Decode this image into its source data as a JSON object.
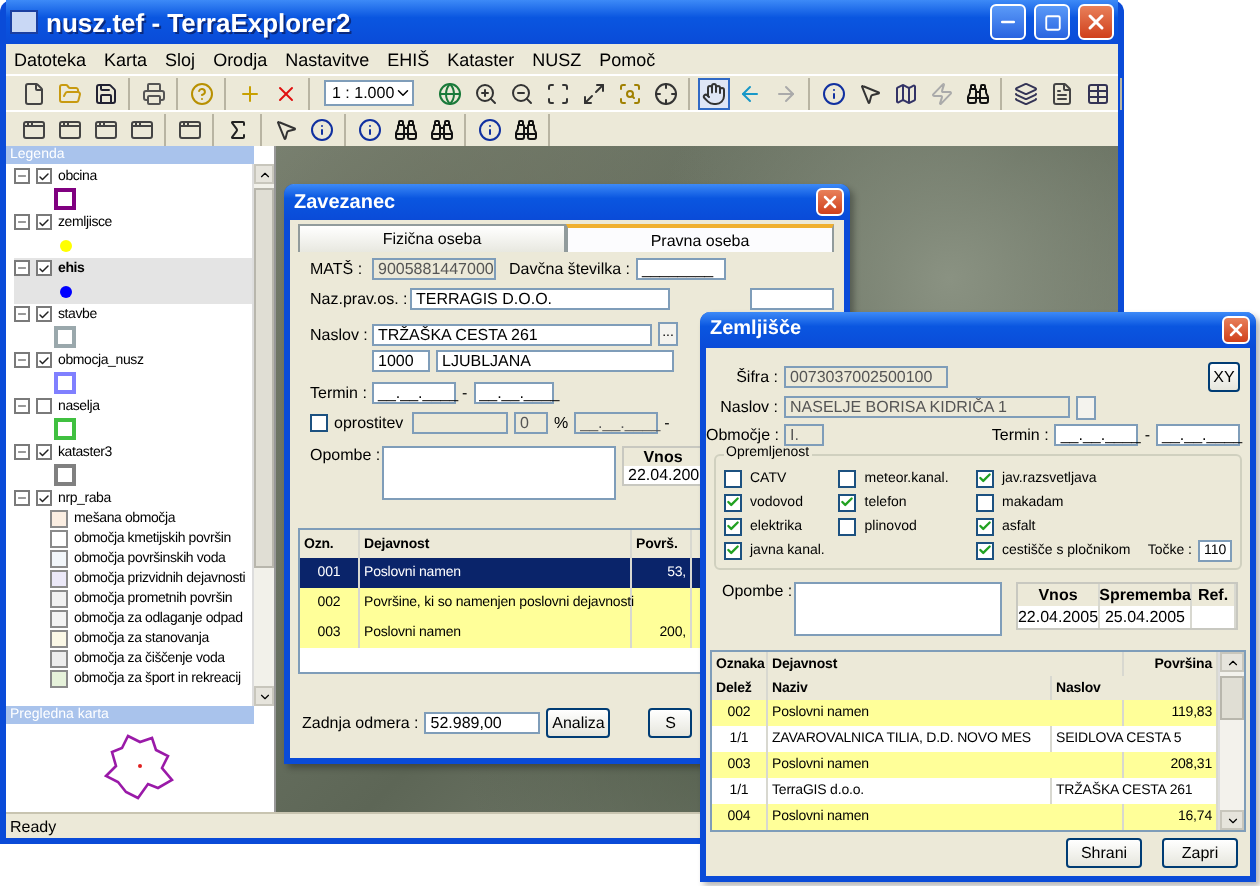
{
  "window": {
    "title": "nusz.tef - TerraExplorer2"
  },
  "menu": [
    "Datoteka",
    "Karta",
    "Sloj",
    "Orodja",
    "Nastavitve",
    "EHIŠ",
    "Kataster",
    "NUSZ",
    "Pomoč"
  ],
  "toolbar": {
    "left_groups": [
      [
        {
          "kind": "new",
          "pressed": false,
          "disabled": false
        },
        {
          "kind": "open",
          "pressed": false,
          "disabled": false
        },
        {
          "kind": "save",
          "pressed": false,
          "disabled": false
        }
      ],
      [
        {
          "kind": "print",
          "pressed": false,
          "disabled": false
        }
      ],
      [
        {
          "kind": "help",
          "pressed": false,
          "disabled": false
        }
      ],
      [
        {
          "kind": "add",
          "pressed": false,
          "disabled": false
        },
        {
          "kind": "delete",
          "pressed": false,
          "disabled": false
        }
      ]
    ],
    "scale": "1 : 1.000",
    "right_groups": [
      [
        {
          "kind": "globe",
          "pressed": false,
          "disabled": false
        },
        {
          "kind": "zoom-in",
          "pressed": false,
          "disabled": false
        },
        {
          "kind": "zoom-out",
          "pressed": false,
          "disabled": false
        },
        {
          "kind": "zoom-extent",
          "pressed": false,
          "disabled": false
        },
        {
          "kind": "zoom-window",
          "pressed": false,
          "disabled": false
        },
        {
          "kind": "zoom-select",
          "pressed": false,
          "disabled": false
        },
        {
          "kind": "zoom-layer",
          "pressed": false,
          "disabled": false
        }
      ],
      [
        {
          "kind": "hand",
          "pressed": true,
          "disabled": false
        },
        {
          "kind": "back",
          "pressed": false,
          "disabled": false
        },
        {
          "kind": "forward",
          "pressed": false,
          "disabled": true
        }
      ],
      [
        {
          "kind": "info",
          "pressed": false,
          "disabled": false
        },
        {
          "kind": "pointer",
          "pressed": false,
          "disabled": false
        },
        {
          "kind": "map",
          "pressed": false,
          "disabled": false
        },
        {
          "kind": "lightning",
          "pressed": false,
          "disabled": true
        },
        {
          "kind": "binoculars",
          "pressed": false,
          "disabled": false
        }
      ],
      [
        {
          "kind": "layers",
          "pressed": false,
          "disabled": false
        },
        {
          "kind": "document",
          "pressed": false,
          "disabled": false
        },
        {
          "kind": "table",
          "pressed": false,
          "disabled": false
        }
      ]
    ]
  },
  "toolbar2": [
    [
      {
        "kind": "frame"
      },
      {
        "kind": "frame"
      },
      {
        "kind": "frame"
      },
      {
        "kind": "frame"
      }
    ],
    [
      {
        "kind": "frame"
      }
    ],
    [
      {
        "kind": "sigma"
      }
    ],
    [
      {
        "kind": "pointer"
      },
      {
        "kind": "info"
      }
    ],
    [
      {
        "kind": "info"
      },
      {
        "kind": "binoculars"
      },
      {
        "kind": "binoculars"
      }
    ],
    [
      {
        "kind": "info"
      },
      {
        "kind": "binoculars"
      }
    ]
  ],
  "legend": {
    "title": "Legenda",
    "layers": [
      {
        "name": "obcina",
        "checked": true,
        "expanded": true,
        "selected": false,
        "symbol": {
          "kind": "square",
          "color": "#800080"
        }
      },
      {
        "name": "zemljisce",
        "checked": true,
        "expanded": true,
        "selected": false,
        "symbol": {
          "kind": "dot",
          "color": "#ffff00"
        }
      },
      {
        "name": "ehis",
        "checked": true,
        "expanded": true,
        "selected": true,
        "symbol": {
          "kind": "dot",
          "color": "#0000ff"
        }
      },
      {
        "name": "stavbe",
        "checked": true,
        "expanded": true,
        "selected": false,
        "symbol": {
          "kind": "square",
          "color": "#9aa8ac"
        }
      },
      {
        "name": "obmocja_nusz",
        "checked": true,
        "expanded": true,
        "selected": false,
        "symbol": {
          "kind": "square",
          "color": "#8080ff"
        }
      },
      {
        "name": "naselja",
        "checked": false,
        "expanded": true,
        "selected": false,
        "symbol": {
          "kind": "square",
          "color": "#40c040"
        }
      },
      {
        "name": "kataster3",
        "checked": true,
        "expanded": true,
        "selected": false,
        "symbol": {
          "kind": "square",
          "color": "#808080"
        }
      },
      {
        "name": "nrp_raba",
        "checked": true,
        "expanded": true,
        "selected": false,
        "children": [
          {
            "name": "mešana območja",
            "color": "#fbeee2"
          },
          {
            "name": "območja kmetijskih površin",
            "color": "#ffffff"
          },
          {
            "name": "območja površinskih voda",
            "color": "#f2f6fa"
          },
          {
            "name": "območja prizvidnih dejavnosti",
            "color": "#ebe8f8"
          },
          {
            "name": "območja prometnih površin",
            "color": "#f0f0f0"
          },
          {
            "name": "območja za  odlaganje odpad",
            "color": "#f3f3f3"
          },
          {
            "name": "območja za stanovanja",
            "color": "#fbf8e6"
          },
          {
            "name": "območja za čiščenje voda",
            "color": "#ededed"
          },
          {
            "name": "območja za šport in  rekreacij",
            "color": "#e6f2da"
          }
        ]
      }
    ]
  },
  "overview": {
    "title": "Pregledna karta"
  },
  "status_bar": "Ready",
  "zavezanec": {
    "title": "Zavezanec",
    "tabs": [
      {
        "label": "Fizična oseba",
        "selected": false
      },
      {
        "label": "Pravna oseba",
        "selected": true
      }
    ],
    "matst": {
      "label": "MATŠ :",
      "field": {
        "value": "9005881447000",
        "disabled": true
      }
    },
    "davcna": {
      "label": "Davčna številka :",
      "field": {
        "value": "________",
        "disabled": false
      }
    },
    "naziv": {
      "label": "Naz.prav.os. :",
      "field": {
        "value": "TERRAGIS D.O.O.",
        "disabled": false
      },
      "field_2": {
        "disabled": false
      }
    },
    "naslov": {
      "label": "Naslov :",
      "street": {
        "value": "TRŽAŠKA CESTA 261",
        "disabled": false
      },
      "browse": "...",
      "postal": {
        "value": "1000",
        "disabled": false
      },
      "city": {
        "value": "LJUBLJANA",
        "disabled": false
      }
    },
    "termin": {
      "label": "Termin :",
      "from": {
        "value": "__.__.____",
        "disabled": false
      },
      "separator": "-",
      "to": {
        "value": "__.__.____",
        "disabled": false
      }
    },
    "oprostitev": {
      "label": "oprostitev",
      "checked": false,
      "field_1": {
        "disabled": true
      },
      "percent": {
        "value": "0",
        "disabled": true
      },
      "percent_sign": "%",
      "date": {
        "value": "__.__.____",
        "disabled": true
      },
      "separator": "-"
    },
    "opombe": {
      "label": "Opombe :"
    },
    "dates": {
      "column": "Vnos",
      "value": "22.04.200"
    },
    "table": {
      "columns": [
        "Ozn.",
        "Dejavnost",
        "Površ."
      ],
      "rows": [
        {
          "code": "001",
          "activity": "Poslovni namen",
          "area": "53,",
          "selected": true
        },
        {
          "code": "002",
          "activity": "Površine, ki so namenjen poslovni dejavnosti",
          "area": "",
          "selected": false
        },
        {
          "code": "003",
          "activity": "Poslovni namen",
          "area": "200,",
          "selected": false
        }
      ]
    },
    "odmera": {
      "label": "Zadnja odmera :",
      "field": {
        "value": "52.989,00",
        "disabled": false
      }
    },
    "buttons": [
      "Analiza",
      "S"
    ]
  },
  "zemljisce": {
    "title": "Zemljišče",
    "sifra": {
      "label": "Šifra :",
      "field": {
        "value": "0073037002500100",
        "disabled": true
      }
    },
    "xy_button": "XY",
    "naslov": {
      "label": "Naslov :",
      "field": {
        "value": "NASELJE BORISA KIDRIČA 1",
        "disabled": true
      }
    },
    "obmocje": {
      "label": "Območje :",
      "field": {
        "value": "I.",
        "disabled": true
      }
    },
    "termin": {
      "label": "Termin :",
      "from": {
        "value": "__.__.____",
        "disabled": false
      },
      "separator": "-",
      "to": {
        "value": "__.__.____",
        "disabled": false
      }
    },
    "opremljenost": {
      "title": "Opremljenost",
      "columns": [
        [
          {
            "label": "CATV",
            "checked": false
          },
          {
            "label": "vodovod",
            "checked": true
          },
          {
            "label": "elektrika",
            "checked": true
          },
          {
            "label": "javna kanal.",
            "checked": true
          }
        ],
        [
          {
            "label": "meteor.kanal.",
            "checked": false
          },
          {
            "label": "telefon",
            "checked": true
          },
          {
            "label": "plinovod",
            "checked": false
          }
        ],
        [
          {
            "label": "jav.razsvetljava",
            "checked": true
          },
          {
            "label": "makadam",
            "checked": false
          },
          {
            "label": "asfalt",
            "checked": true
          },
          {
            "label": "cestišče s pločnikom",
            "checked": true
          }
        ]
      ],
      "tocke": {
        "label": "Točke :",
        "value": "110"
      }
    },
    "opombe": {
      "label": "Opombe :"
    },
    "dates": {
      "columns": [
        "Vnos",
        "Sprememba",
        "Ref."
      ],
      "values": [
        "22.04.2005",
        "25.04.2005"
      ]
    },
    "table": {
      "columns": [
        [
          "Oznaka",
          "Dejavnost",
          "Površina"
        ],
        [
          "Delež",
          "Naziv",
          "Naslov"
        ]
      ],
      "rows": [
        {
          "kind": "activity",
          "cells": [
            "002",
            "Poslovni namen",
            "119,83"
          ]
        },
        {
          "kind": "owner",
          "cells": [
            "1/1",
            "ZAVAROVALNICA TILIA, D.D. NOVO MES",
            "SEIDLOVA CESTA 5"
          ]
        },
        {
          "kind": "activity",
          "cells": [
            "003",
            "Poslovni namen",
            "208,31"
          ]
        },
        {
          "kind": "owner",
          "cells": [
            "1/1",
            "TerraGIS d.o.o.",
            "TRŽAŠKA CESTA 261"
          ]
        },
        {
          "kind": "activity",
          "cells": [
            "004",
            "Poslovni namen",
            "16,74"
          ]
        }
      ]
    },
    "buttons": [
      "Shrani",
      "Zapri"
    ]
  }
}
